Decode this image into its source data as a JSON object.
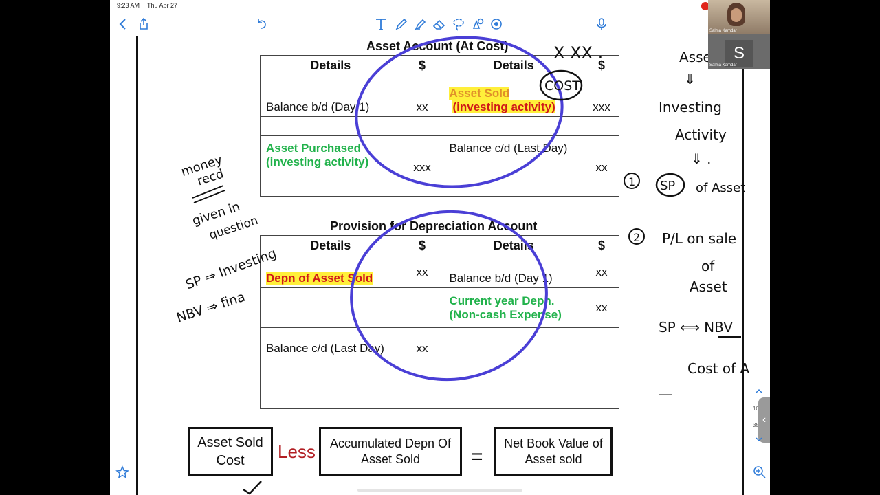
{
  "status_bar": {
    "time": "9:23 AM",
    "date": "Thu Apr 27"
  },
  "toolbar": {
    "icons": [
      "chevron-left-icon",
      "share-icon",
      "undo-icon",
      "text-tool-icon",
      "pen-icon",
      "highlighter-icon",
      "eraser-icon",
      "lasso-icon",
      "shapes-icon",
      "color-picker-icon",
      "microphone-icon"
    ]
  },
  "asset_account": {
    "title": "Asset Account (At Cost)",
    "headers": {
      "details_left": "Details",
      "amount_left": "$",
      "details_right": "Details",
      "amount_right": "$"
    },
    "rows": [
      {
        "left": "Balance b/d (Day 1)",
        "left_amt": "xx",
        "right_line1": "Asset Sold",
        "right_line2": "(investing activity)",
        "right_amt": "xxx"
      },
      {
        "left_line1": "Asset Purchased",
        "left_line2": "(investing activity)",
        "left_amt": "xxx",
        "right": "Balance c/d (Last Day)",
        "right_amt": "xx"
      }
    ]
  },
  "provision_account": {
    "title": "Provision for Depreciation Account",
    "headers": {
      "details_left": "Details",
      "amount_left": "$",
      "details_right": "Details",
      "amount_right": "$"
    },
    "rows": [
      {
        "left": "Depn of Asset Sold",
        "left_amt": "xx",
        "right": "Balance b/d (Day 1)",
        "right_amt": "xx"
      },
      {
        "right_line1": "Current year Depn.",
        "right_line2": "(Non-cash Expense)",
        "right_amt": "xx"
      },
      {
        "left": "Balance c/d (Last Day)",
        "left_amt": "xx"
      }
    ]
  },
  "formula": {
    "box1": "Asset Sold Cost",
    "operator1": "Less",
    "box2": "Accumulated Depn Of Asset Sold",
    "operator2": "=",
    "box3": "Net Book Value of Asset sold"
  },
  "handwriting": {
    "top_marks": "X XX .",
    "cost_circled": "COST",
    "left_notes": [
      "money",
      "recd",
      "given in",
      "question",
      "SP ⇒ Investing",
      "NBV ⇒ fina"
    ],
    "right_notes": [
      "Asse",
      "⇓",
      "Investing",
      "Activity",
      "⇓ .",
      "1",
      "SP",
      "of Asset",
      "2",
      "P/L on sale",
      "of",
      "Asset",
      "SP ⟺ NBV",
      "Cost of A",
      "—"
    ]
  },
  "video": {
    "participant_name": "Salma Kamdar",
    "avatar_letter": "S"
  },
  "side_panel": {
    "page_numbers": [
      "10",
      "35"
    ]
  },
  "colors": {
    "ink_blue": "#4a3fd6",
    "green": "#21b24b",
    "highlight": "#ffef3a",
    "red": "#d01919",
    "less_red": "#b21f24",
    "toolbar_blue": "#2f7bd8"
  }
}
